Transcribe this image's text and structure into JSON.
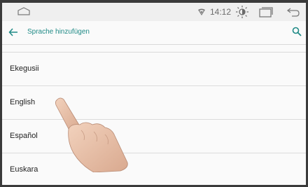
{
  "status_bar": {
    "time": "14:12",
    "icons": [
      "home-outline-icon",
      "wifi-icon",
      "brightness-icon",
      "recents-icon",
      "back-arrow-icon"
    ]
  },
  "app_bar": {
    "title": "Sprache hinzufügen",
    "back_icon": "arrow-left-icon",
    "search_icon": "search-icon",
    "accent_color": "#1f8a86"
  },
  "languages": {
    "items": [
      "Ekegusii",
      "English",
      "Español",
      "Euskara"
    ]
  }
}
